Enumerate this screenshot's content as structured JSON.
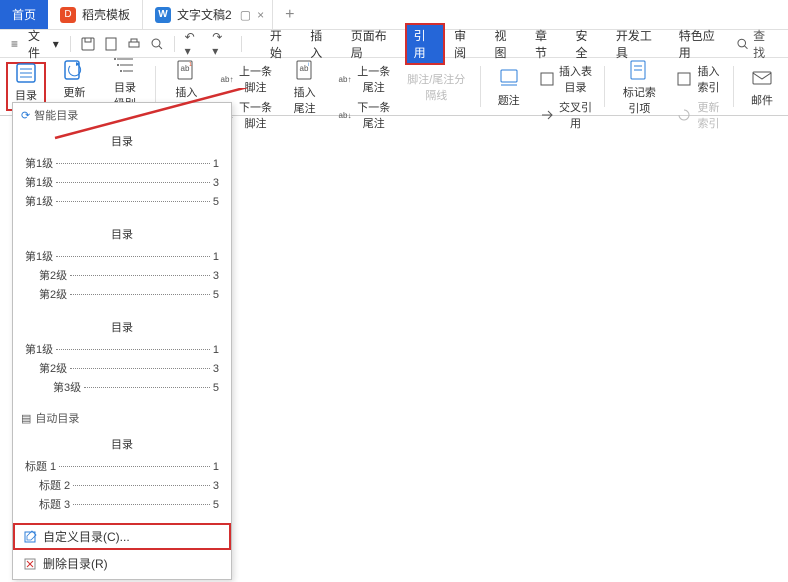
{
  "titlebar": {
    "home": "首页",
    "template": "稻壳模板",
    "doc": "文字文稿2"
  },
  "toolbar": {
    "file": "文件",
    "search": "查找"
  },
  "menutabs": {
    "start": "开始",
    "insert": "插入",
    "layout": "页面布局",
    "reference": "引用",
    "review": "审阅",
    "view": "视图",
    "chapter": "章节",
    "security": "安全",
    "dev": "开发工具",
    "special": "特色应用"
  },
  "ribbon": {
    "toc": "目录",
    "update_toc": "更新目录",
    "toc_level": "目录级别",
    "insert_footnote": "插入脚注",
    "prev_footnote": "上一条脚注",
    "next_footnote": "下一条脚注",
    "insert_endnote": "插入尾注",
    "prev_endnote": "上一条尾注",
    "next_endnote": "下一条尾注",
    "footnote_endnote_sep": "脚注/尾注分隔线",
    "caption": "题注",
    "insert_fig_toc": "插入表目录",
    "cross_ref": "交叉引用",
    "mark_index": "标记索引项",
    "insert_index": "插入索引",
    "update_index": "更新索引",
    "mail": "邮件"
  },
  "dropdown": {
    "smart_toc": "智能目录",
    "auto_toc": "自动目录",
    "custom_toc": "自定义目录(C)...",
    "delete_toc": "删除目录(R)",
    "toc_title": "目录",
    "lvl1": "第1级",
    "lvl2": "第2级",
    "lvl3": "第3级",
    "heading1": "标题 1",
    "heading2": "标题 2",
    "heading3": "标题 3",
    "p1": "1",
    "p3": "3",
    "p5": "5"
  }
}
